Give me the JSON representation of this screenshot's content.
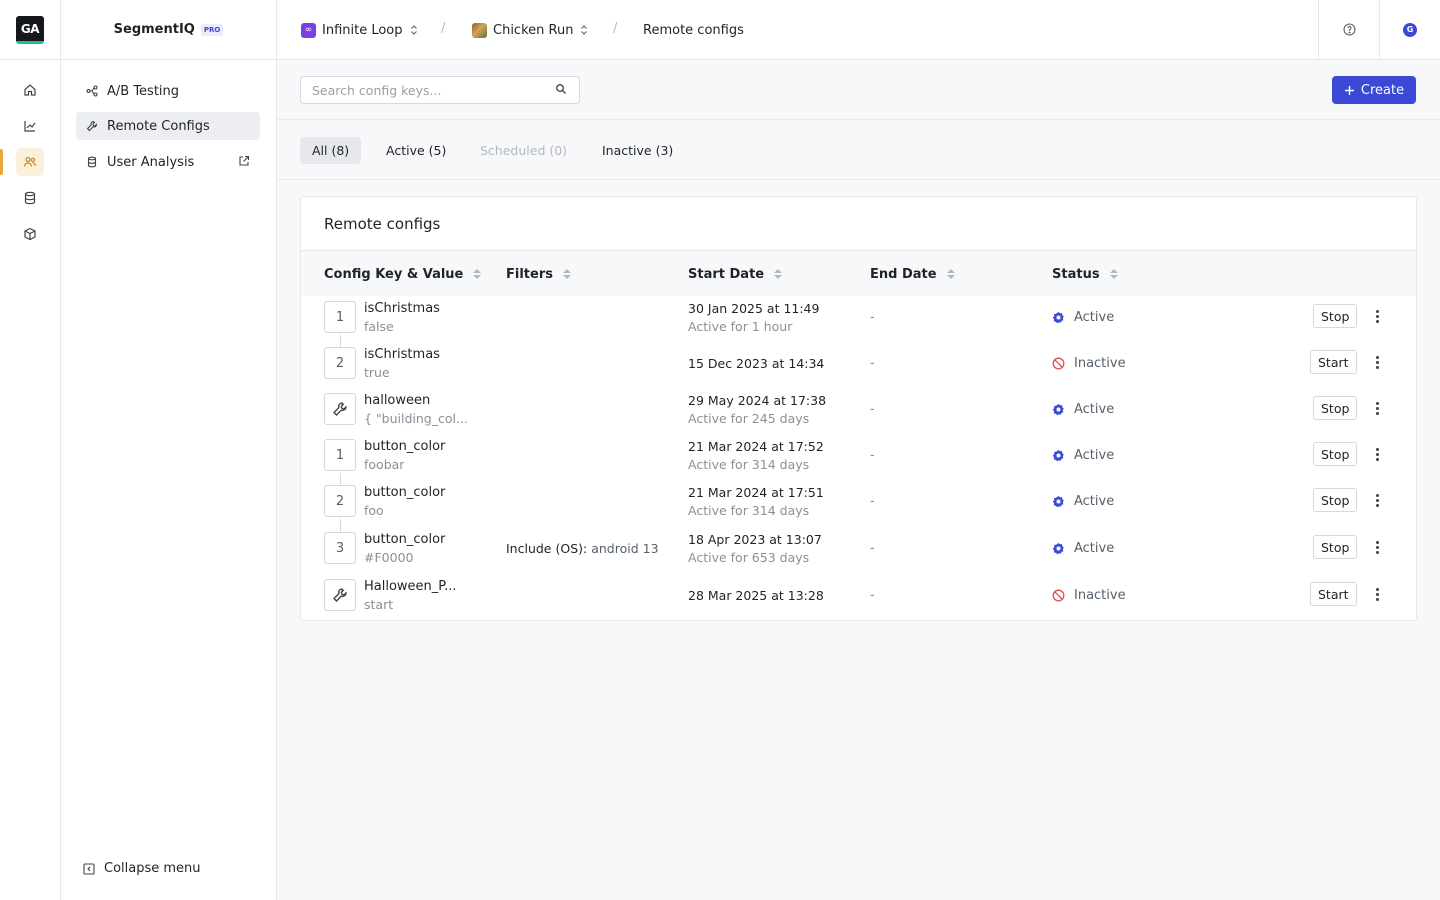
{
  "rail": {
    "logo_text": "GA"
  },
  "sidebar": {
    "title": "SegmentIQ",
    "badge": "PRO",
    "items": [
      {
        "label": "A/B Testing",
        "icon": "ab-testing-icon"
      },
      {
        "label": "Remote Configs",
        "icon": "wrench-icon"
      },
      {
        "label": "User Analysis",
        "icon": "database-icon"
      }
    ],
    "collapse_label": "Collapse menu"
  },
  "breadcrumb": {
    "app": "Infinite Loop",
    "app_badge": "∞",
    "game": "Chicken Run",
    "page": "Remote configs"
  },
  "header": {
    "avatar_letter": "G"
  },
  "search": {
    "placeholder": "Search config keys..."
  },
  "create_label": "Create",
  "tabs": [
    {
      "label": "All (8)"
    },
    {
      "label": "Active (5)"
    },
    {
      "label": "Scheduled (0)"
    },
    {
      "label": "Inactive (3)"
    }
  ],
  "table": {
    "title": "Remote configs",
    "columns": [
      "Config Key & Value",
      "Filters",
      "Start Date",
      "End Date",
      "Status"
    ],
    "rows": [
      {
        "marker": "1",
        "key": "isChristmas",
        "value": "false",
        "filter_label": "",
        "filter_value": "",
        "start": "30 Jan 2025 at 11:49",
        "since": "Active for 1 hour",
        "end": "-",
        "status": "Active",
        "action": "Stop"
      },
      {
        "marker": "2",
        "key": "isChristmas",
        "value": "true",
        "filter_label": "",
        "filter_value": "",
        "start": "15 Dec 2023 at 14:34",
        "since": "",
        "end": "-",
        "status": "Inactive",
        "action": "Start"
      },
      {
        "marker": "",
        "key": "halloween",
        "value": "{ \"building_col...",
        "filter_label": "",
        "filter_value": "",
        "start": "29 May 2024 at 17:38",
        "since": "Active for 245 days",
        "end": "-",
        "status": "Active",
        "action": "Stop"
      },
      {
        "marker": "1",
        "key": "button_color",
        "value": "foobar",
        "filter_label": "",
        "filter_value": "",
        "start": "21 Mar 2024 at 17:52",
        "since": "Active for 314 days",
        "end": "-",
        "status": "Active",
        "action": "Stop"
      },
      {
        "marker": "2",
        "key": "button_color",
        "value": "foo",
        "filter_label": "",
        "filter_value": "",
        "start": "21 Mar 2024 at 17:51",
        "since": "Active for 314 days",
        "end": "-",
        "status": "Active",
        "action": "Stop"
      },
      {
        "marker": "3",
        "key": "button_color",
        "value": "#F0000",
        "filter_label": "Include (OS):",
        "filter_value": "android 13",
        "start": "18 Apr 2023 at 13:07",
        "since": "Active for 653 days",
        "end": "-",
        "status": "Active",
        "action": "Stop"
      },
      {
        "marker": "",
        "key": "Halloween_P...",
        "value": "start",
        "filter_label": "",
        "filter_value": "",
        "start": "28 Mar 2025 at 13:28",
        "since": "",
        "end": "-",
        "status": "Inactive",
        "action": "Start"
      }
    ]
  },
  "colors": {
    "accent": "#3b49d6",
    "rail_active": "#fbf0d9",
    "inactive": "#d9534f"
  }
}
